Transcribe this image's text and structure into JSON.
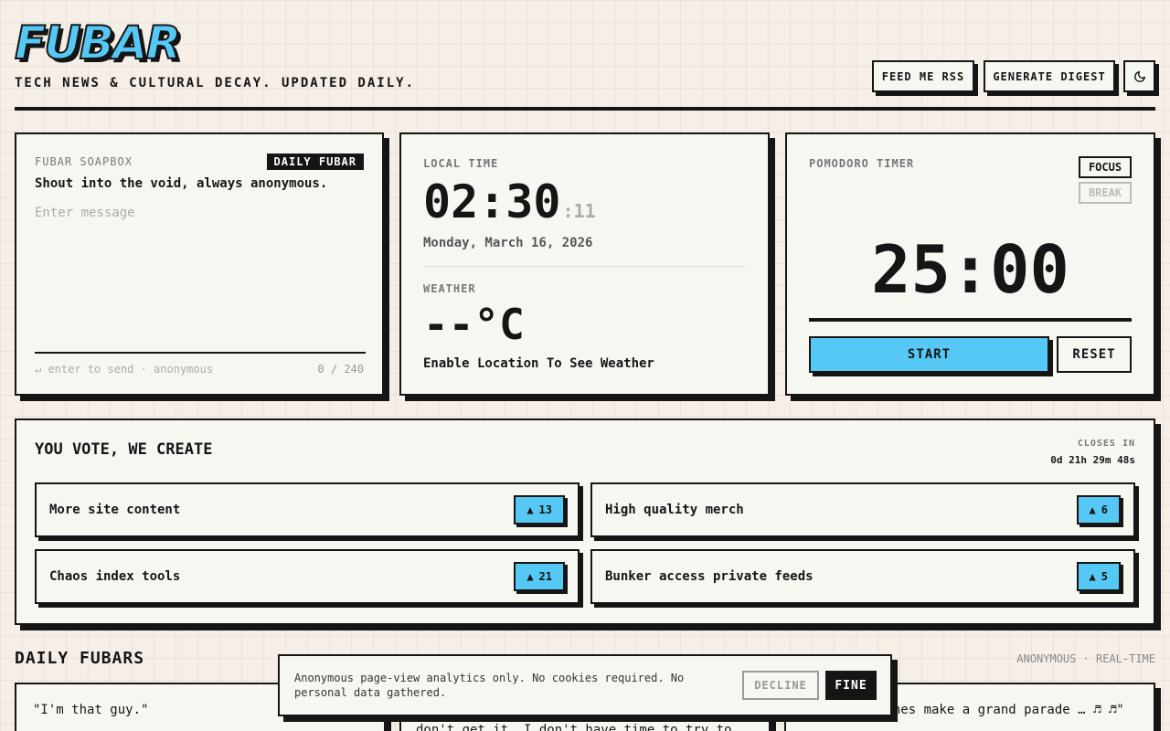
{
  "header": {
    "logo": "FUBAR",
    "tagline": "TECH NEWS & CULTURAL DECAY. UPDATED DAILY.",
    "rss_label": "FEED ME RSS",
    "digest_label": "GENERATE DIGEST",
    "theme_icon": "moon-icon"
  },
  "soapbox": {
    "label": "FUBAR SOAPBOX",
    "badge": "DAILY FUBAR",
    "subtitle": "Shout into the void, always anonymous.",
    "placeholder": "Enter message",
    "hint": "↵ enter to send · anonymous",
    "counter": "0 / 240"
  },
  "clock": {
    "label": "LOCAL TIME",
    "time": "02:30",
    "seconds": ":11",
    "date": "Monday, March 16, 2026",
    "weather_label": "WEATHER",
    "temp": "--°C",
    "weather_msg": "Enable Location To See Weather"
  },
  "pomodoro": {
    "label": "POMODORO TIMER",
    "mode_focus": "FOCUS",
    "mode_break": "BREAK",
    "display": "25:00",
    "start_label": "START",
    "reset_label": "RESET"
  },
  "vote": {
    "title": "YOU VOTE, WE CREATE",
    "closes_label": "CLOSES IN",
    "closes_value": "0d 21h 29m 48s",
    "items": [
      {
        "title": "More site content",
        "votes": "13"
      },
      {
        "title": "High quality merch",
        "votes": "6"
      },
      {
        "title": "Chaos index tools",
        "votes": "21"
      },
      {
        "title": "Bunker access private feeds",
        "votes": "5"
      }
    ]
  },
  "daily": {
    "title": "DAILY FUBARS",
    "meta": "ANONYMOUS · REAL-TIME",
    "cards": [
      {
        "text": "\"I'm that guy.\""
      },
      {
        "text": "don't get it. I don't have time to try to"
      },
      {
        "text": "bones make a grand parade … ♬ ♬\""
      }
    ]
  },
  "cookie": {
    "text": "Anonymous page-view analytics only. No cookies required. No personal data gathered.",
    "decline_label": "DECLINE",
    "accept_label": "FINE"
  },
  "colors": {
    "accent": "#56c8f5",
    "ink": "#151515",
    "paper": "#f7f7f2",
    "background": "#f5efe7"
  }
}
